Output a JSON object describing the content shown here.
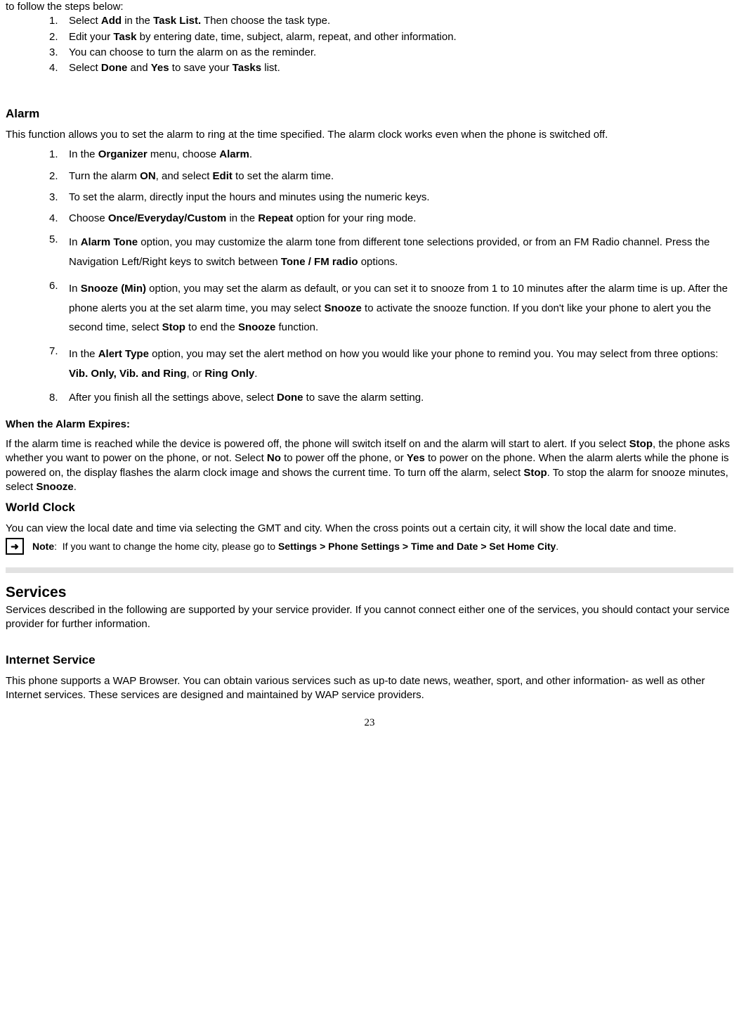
{
  "intro_line": "to follow the steps below:",
  "task_list": {
    "n1": "1.",
    "t1a": "Select ",
    "t1b": "Add",
    "t1c": " in the ",
    "t1d": "Task List.",
    "t1e": " Then choose the task type.",
    "n2": "2.",
    "t2a": "Edit your ",
    "t2b": "Task",
    "t2c": " by entering date, time, subject, alarm, repeat, and other information.",
    "n3": "3.",
    "t3a": "You can choose to turn the alarm on as the reminder.",
    "n4": "4.",
    "t4a": "Select ",
    "t4b": "Done",
    "t4c": " and ",
    "t4d": "Yes",
    "t4e": " to save your ",
    "t4f": "Tasks",
    "t4g": " list."
  },
  "alarm_heading": "Alarm",
  "alarm_intro": "This function allows you to set the alarm to ring at the time specified. The alarm clock works even when the phone is switched off.",
  "alarm_list": {
    "n1": "1.",
    "a1a": "In the ",
    "a1b": "Organizer",
    "a1c": " menu, choose ",
    "a1d": "Alarm",
    "a1e": ".",
    "n2": "2.",
    "a2a": "Turn the alarm ",
    "a2b": "ON",
    "a2c": ", and select ",
    "a2d": "Edit",
    "a2e": " to set the alarm time.",
    "n3": "3.",
    "a3a": "To set the alarm, directly input the hours and minutes using the numeric keys.",
    "n4": "4.",
    "a4a": "Choose ",
    "a4b": "Once/Everyday/Custom",
    "a4c": " in the ",
    "a4d": "Repeat",
    "a4e": " option for your ring mode.",
    "n5": "5.",
    "a5a": "In ",
    "a5b": "Alarm Tone",
    "a5c": " option, you may customize the alarm tone from different tone selections provided, or from an FM Radio channel. Press the Navigation Left/Right keys to switch between ",
    "a5d": "Tone / FM radio",
    "a5e": " options.",
    "n6": "6.",
    "a6a": "In ",
    "a6b": "Snooze (Min)",
    "a6c": " option, you may set the alarm as default, or you can set it to snooze from 1 to 10 minutes after the alarm time is up. After the phone alerts you at the set alarm time, you may select ",
    "a6d": "Snooze",
    "a6e": " to activate the snooze function. If you don't like your phone to alert you the second time, select ",
    "a6f": "Stop",
    "a6g": " to end the ",
    "a6h": "Snooze",
    "a6i": " function.",
    "n7": "7.",
    "a7a": "In the ",
    "a7b": "Alert Type",
    "a7c": " option, you may set the alert method on how you would like your phone to remind you. You may select from three options: ",
    "a7d": "Vib. Only, Vib. and Ring",
    "a7e": ", or ",
    "a7f": "Ring Only",
    "a7g": ".",
    "n8": "8.",
    "a8a": "After you finish all the settings above, select ",
    "a8b": "Done",
    "a8c": " to save the alarm setting."
  },
  "expire_heading": "When the Alarm Expires:",
  "expire_p_a": "If the alarm time is reached while the device is powered off, the phone will switch itself on and the alarm will start to alert. If you select ",
  "expire_p_b": "Stop",
  "expire_p_c": ", the phone asks whether you want to power on the phone, or not. Select ",
  "expire_p_d": "No",
  "expire_p_e": " to power off the phone, or ",
  "expire_p_f": "Yes",
  "expire_p_g": " to power on the phone. When the alarm alerts while the phone is powered on, the display flashes the alarm clock image and shows the current time. To turn off the alarm, select ",
  "expire_p_h": "Stop",
  "expire_p_i": ". To stop the alarm for snooze minutes, select ",
  "expire_p_j": "Snooze",
  "expire_p_k": ".",
  "world_clock_heading": "World Clock",
  "world_clock_text": "You can view the local date and time via selecting the GMT and city. When the cross points out a certain city, it will show the local date and time.",
  "note_label": "Note",
  "note_colon": ":",
  "note_text_a": "If you want to change the home city, please go to ",
  "note_text_b": "Settings > Phone Settings > Time and Date > Set Home City",
  "note_text_c": ".",
  "services_heading": "Services",
  "services_text": "Services described in the following are supported by your service provider. If you cannot connect either one of the services, you should contact your service provider for further information.",
  "internet_heading": "Internet Service",
  "internet_text": "This phone supports a WAP Browser. You can obtain various services such as up-to date news, weather, sport, and other information- as well as other Internet services. These services are designed and maintained by WAP service providers.",
  "page_number": "23",
  "arrow_glyph": "➜"
}
